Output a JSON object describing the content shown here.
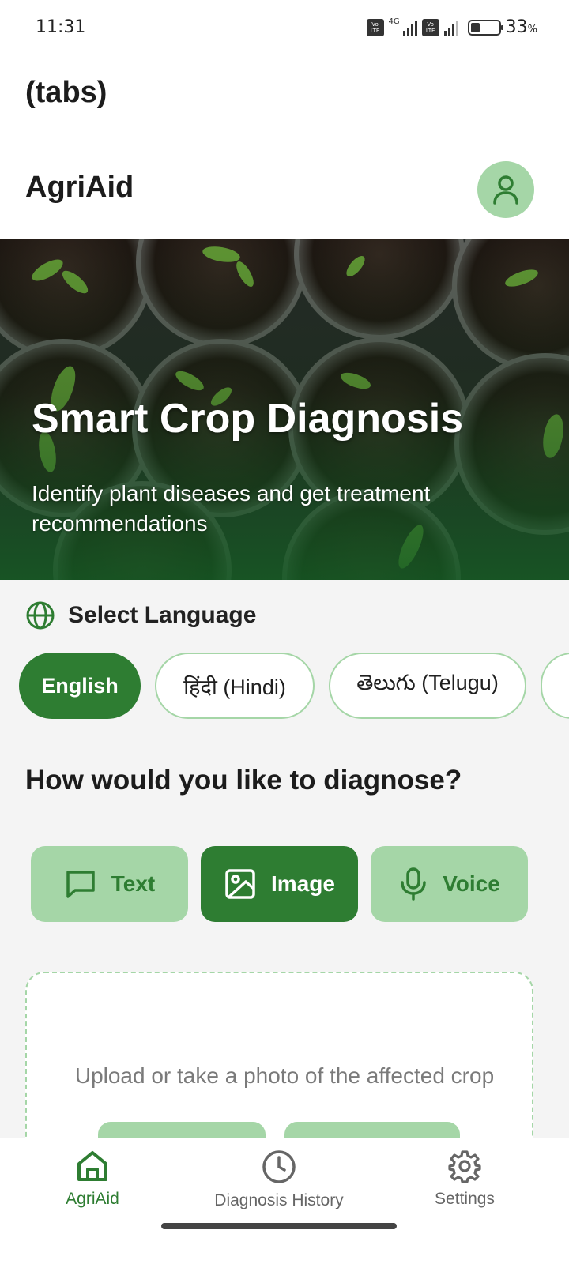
{
  "status_bar": {
    "time": "11:31",
    "battery_percent": "33",
    "battery_level": 0.33,
    "network": "4G"
  },
  "header": {
    "tabs_label": "(tabs)",
    "app_title": "AgriAid",
    "avatar_icon": "user-icon"
  },
  "hero": {
    "title": "Smart Crop Diagnosis",
    "subtitle": "Identify plant diseases and get treatment recommendations"
  },
  "language": {
    "title": "Select Language",
    "icon": "globe-icon",
    "options": [
      {
        "label": "English",
        "active": true
      },
      {
        "label": "हिंदी (Hindi)",
        "active": false
      },
      {
        "label": "తెలుగు (Telugu)",
        "active": false
      }
    ]
  },
  "diagnose": {
    "title": "How would you like to diagnose?",
    "modes": [
      {
        "label": "Text",
        "icon": "message-icon",
        "active": false
      },
      {
        "label": "Image",
        "icon": "image-icon",
        "active": true
      },
      {
        "label": "Voice",
        "icon": "microphone-icon",
        "active": false
      }
    ]
  },
  "upload": {
    "prompt": "Upload or take a photo of the affected crop"
  },
  "bottom_nav": {
    "items": [
      {
        "label": "AgriAid",
        "icon": "home-icon",
        "active": true
      },
      {
        "label": "Diagnosis History",
        "icon": "clock-icon",
        "active": false
      },
      {
        "label": "Settings",
        "icon": "gear-icon",
        "active": false
      }
    ]
  },
  "colors": {
    "primary": "#2e7d32",
    "primary_light": "#a5d6a7",
    "background": "#f4f4f4"
  }
}
